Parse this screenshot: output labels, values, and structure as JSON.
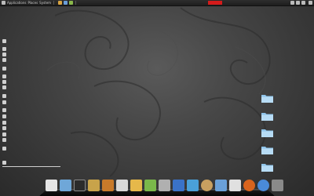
{
  "topbar": {
    "app_menu": [
      "Applications",
      "Places",
      "System"
    ],
    "window_title": "",
    "clock": ""
  },
  "conky": {
    "rows": [
      {
        "label": "",
        "icon": "system-icon"
      },
      {
        "label": "",
        "icon": "distro-icon"
      },
      {
        "label": "",
        "icon": "kernel-icon"
      },
      {
        "label": "",
        "icon": "uptime-icon"
      },
      {
        "label": "",
        "icon": "cpu-icon"
      },
      {
        "label": "",
        "icon": "cpu-temp-icon"
      },
      {
        "label": "",
        "icon": "fan-icon"
      },
      {
        "label": "",
        "icon": "memory-icon"
      },
      {
        "label": "",
        "icon": "swap-icon"
      },
      {
        "label": "",
        "icon": "processes-icon"
      },
      {
        "label": "",
        "icon": "disk-root-icon"
      },
      {
        "label": "",
        "icon": "disk-home-icon"
      },
      {
        "label": "",
        "icon": "network-down-icon"
      },
      {
        "label": "",
        "icon": "network-up-icon"
      },
      {
        "label": "",
        "icon": "battery-icon"
      },
      {
        "label": "",
        "icon": "volume-icon"
      },
      {
        "label": "",
        "icon": "date-icon"
      },
      {
        "label": "",
        "icon": "music-icon"
      }
    ]
  },
  "desktop": {
    "folders": [
      {
        "label": ""
      },
      {
        "label": ""
      },
      {
        "label": ""
      },
      {
        "label": ""
      },
      {
        "label": ""
      }
    ]
  },
  "dock": {
    "items": [
      {
        "icon": "accessories-icon",
        "color": "#e6e6e6"
      },
      {
        "icon": "photos-icon",
        "color": "#6fa7d8"
      },
      {
        "icon": "terminal-icon",
        "color": "#2b2b2b"
      },
      {
        "icon": "file-manager-icon",
        "color": "#c8a34a"
      },
      {
        "icon": "media-player-icon",
        "color": "#c87a2a"
      },
      {
        "icon": "flash-icon",
        "color": "#d8d8d8"
      },
      {
        "icon": "graphics-icon",
        "color": "#e6b84a"
      },
      {
        "icon": "image-editor-icon",
        "color": "#7ab84a"
      },
      {
        "icon": "text-editor-icon",
        "color": "#b0b0b0"
      },
      {
        "icon": "office-icon",
        "color": "#3a72c8"
      },
      {
        "icon": "chat-icon",
        "color": "#4aa0d8"
      },
      {
        "icon": "settings-icon",
        "color": "#c8a060"
      },
      {
        "icon": "calendar-icon",
        "color": "#6aa0d8"
      },
      {
        "icon": "notes-icon",
        "color": "#e0e0e0"
      },
      {
        "icon": "browser-icon",
        "color": "#d8641e"
      },
      {
        "icon": "web-icon",
        "color": "#4a8ad8"
      },
      {
        "icon": "trash-icon",
        "color": "#8a8a8a"
      }
    ]
  },
  "colors": {
    "accent_red": "#d41b1b",
    "folder_blue": "#8fc4ea"
  }
}
